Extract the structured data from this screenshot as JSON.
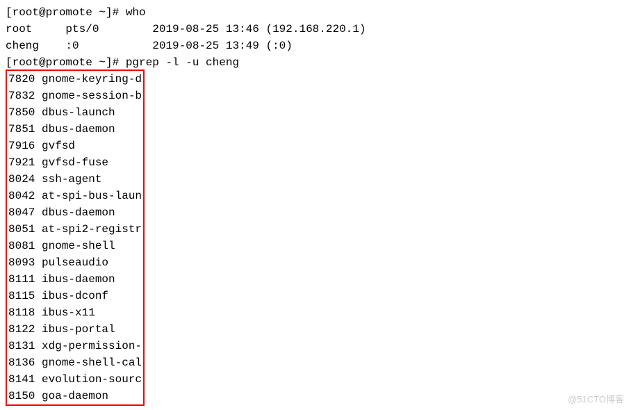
{
  "prompt1": {
    "label": "[root@promote ~]# ",
    "command": "who"
  },
  "who_output": {
    "line1": "root     pts/0        2019-08-25 13:46 (192.168.220.1)",
    "line2": "cheng    :0           2019-08-25 13:49 (:0)"
  },
  "prompt2": {
    "label": "[root@promote ~]# ",
    "command": "pgrep -l -u cheng"
  },
  "pgrep_output": {
    "lines": [
      "7820 gnome-keyring-d",
      "7832 gnome-session-b",
      "7850 dbus-launch",
      "7851 dbus-daemon",
      "7916 gvfsd",
      "7921 gvfsd-fuse",
      "8024 ssh-agent",
      "8042 at-spi-bus-laun",
      "8047 dbus-daemon",
      "8051 at-spi2-registr",
      "8081 gnome-shell",
      "8093 pulseaudio",
      "8111 ibus-daemon",
      "8115 ibus-dconf",
      "8118 ibus-x11",
      "8122 ibus-portal",
      "8131 xdg-permission-",
      "8136 gnome-shell-cal",
      "8141 evolution-sourc",
      "8150 goa-daemon"
    ]
  },
  "watermark": "@51CTO博客"
}
